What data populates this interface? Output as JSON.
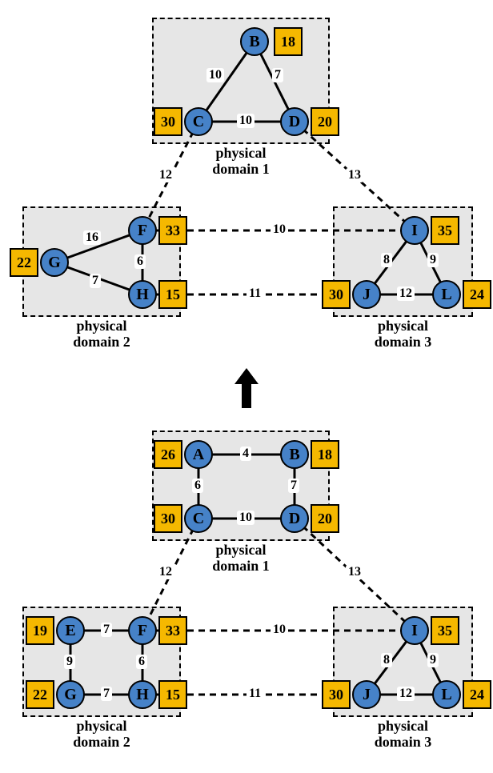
{
  "top": {
    "domains": {
      "d1": {
        "label": "physical\ndomain 1"
      },
      "d2": {
        "label": "physical\ndomain 2"
      },
      "d3": {
        "label": "physical\ndomain 3"
      }
    },
    "nodes": {
      "B": {
        "label": "B",
        "badge": "18"
      },
      "C": {
        "label": "C",
        "badge": "30"
      },
      "D": {
        "label": "D",
        "badge": "20"
      },
      "F": {
        "label": "F",
        "badge": "33"
      },
      "G": {
        "label": "G",
        "badge": "22"
      },
      "H": {
        "label": "H",
        "badge": "15"
      },
      "I": {
        "label": "I",
        "badge": "35"
      },
      "J": {
        "label": "J",
        "badge": "30"
      },
      "L": {
        "label": "L",
        "badge": "24"
      }
    },
    "edges": {
      "BC": "10",
      "BD": "7",
      "CD": "10",
      "CF": "12",
      "DI": "13",
      "FG": "16",
      "FH": "6",
      "GH": "7",
      "FI": "10",
      "HJ": "11",
      "IJ": "8",
      "IL": "9",
      "JL": "12"
    }
  },
  "bottom": {
    "domains": {
      "d1": {
        "label": "physical\ndomain 1"
      },
      "d2": {
        "label": "physical\ndomain 2"
      },
      "d3": {
        "label": "physical\ndomain 3"
      }
    },
    "nodes": {
      "A": {
        "label": "A",
        "badge": "26"
      },
      "B": {
        "label": "B",
        "badge": "18"
      },
      "C": {
        "label": "C",
        "badge": "30"
      },
      "D": {
        "label": "D",
        "badge": "20"
      },
      "E": {
        "label": "E",
        "badge": "19"
      },
      "F": {
        "label": "F",
        "badge": "33"
      },
      "G": {
        "label": "G",
        "badge": "22"
      },
      "H": {
        "label": "H",
        "badge": "15"
      },
      "I": {
        "label": "I",
        "badge": "35"
      },
      "J": {
        "label": "J",
        "badge": "30"
      },
      "L": {
        "label": "L",
        "badge": "24"
      }
    },
    "edges": {
      "AB": "4",
      "AC": "6",
      "BD": "7",
      "CD": "10",
      "CF": "12",
      "DI": "13",
      "EF": "7",
      "EG": "9",
      "FH": "6",
      "GH": "7",
      "FI": "10",
      "HJ": "11",
      "IJ": "8",
      "IL": "9",
      "JL": "12"
    }
  },
  "chart_data": {
    "type": "diagram",
    "description": "Two multi-domain physical network topologies. The bottom shows the full network across 3 physical domains; the top shows a reduced version (nodes A and E removed). An upward arrow indicates the transformation.",
    "top_network": {
      "domains": [
        {
          "name": "physical domain 1",
          "nodes": [
            "B",
            "C",
            "D"
          ]
        },
        {
          "name": "physical domain 2",
          "nodes": [
            "F",
            "G",
            "H"
          ]
        },
        {
          "name": "physical domain 3",
          "nodes": [
            "I",
            "J",
            "L"
          ]
        }
      ],
      "node_weights": {
        "B": 18,
        "C": 30,
        "D": 20,
        "F": 33,
        "G": 22,
        "H": 15,
        "I": 35,
        "J": 30,
        "L": 24
      },
      "edges": [
        {
          "u": "B",
          "v": "C",
          "w": 10,
          "intra": true
        },
        {
          "u": "B",
          "v": "D",
          "w": 7,
          "intra": true
        },
        {
          "u": "C",
          "v": "D",
          "w": 10,
          "intra": true
        },
        {
          "u": "F",
          "v": "G",
          "w": 16,
          "intra": true
        },
        {
          "u": "F",
          "v": "H",
          "w": 6,
          "intra": true
        },
        {
          "u": "G",
          "v": "H",
          "w": 7,
          "intra": true
        },
        {
          "u": "I",
          "v": "J",
          "w": 8,
          "intra": true
        },
        {
          "u": "I",
          "v": "L",
          "w": 9,
          "intra": true
        },
        {
          "u": "J",
          "v": "L",
          "w": 12,
          "intra": true
        },
        {
          "u": "C",
          "v": "F",
          "w": 12,
          "intra": false
        },
        {
          "u": "D",
          "v": "I",
          "w": 13,
          "intra": false
        },
        {
          "u": "F",
          "v": "I",
          "w": 10,
          "intra": false
        },
        {
          "u": "H",
          "v": "J",
          "w": 11,
          "intra": false
        }
      ]
    },
    "bottom_network": {
      "domains": [
        {
          "name": "physical domain 1",
          "nodes": [
            "A",
            "B",
            "C",
            "D"
          ]
        },
        {
          "name": "physical domain 2",
          "nodes": [
            "E",
            "F",
            "G",
            "H"
          ]
        },
        {
          "name": "physical domain 3",
          "nodes": [
            "I",
            "J",
            "L"
          ]
        }
      ],
      "node_weights": {
        "A": 26,
        "B": 18,
        "C": 30,
        "D": 20,
        "E": 19,
        "F": 33,
        "G": 22,
        "H": 15,
        "I": 35,
        "J": 30,
        "L": 24
      },
      "edges": [
        {
          "u": "A",
          "v": "B",
          "w": 4,
          "intra": true
        },
        {
          "u": "A",
          "v": "C",
          "w": 6,
          "intra": true
        },
        {
          "u": "B",
          "v": "D",
          "w": 7,
          "intra": true
        },
        {
          "u": "C",
          "v": "D",
          "w": 10,
          "intra": true
        },
        {
          "u": "E",
          "v": "F",
          "w": 7,
          "intra": true
        },
        {
          "u": "E",
          "v": "G",
          "w": 9,
          "intra": true
        },
        {
          "u": "F",
          "v": "H",
          "w": 6,
          "intra": true
        },
        {
          "u": "G",
          "v": "H",
          "w": 7,
          "intra": true
        },
        {
          "u": "I",
          "v": "J",
          "w": 8,
          "intra": true
        },
        {
          "u": "I",
          "v": "L",
          "w": 9,
          "intra": true
        },
        {
          "u": "J",
          "v": "L",
          "w": 12,
          "intra": true
        },
        {
          "u": "C",
          "v": "F",
          "w": 12,
          "intra": false
        },
        {
          "u": "D",
          "v": "I",
          "w": 13,
          "intra": false
        },
        {
          "u": "F",
          "v": "I",
          "w": 10,
          "intra": false
        },
        {
          "u": "H",
          "v": "J",
          "w": 11,
          "intra": false
        }
      ]
    }
  }
}
